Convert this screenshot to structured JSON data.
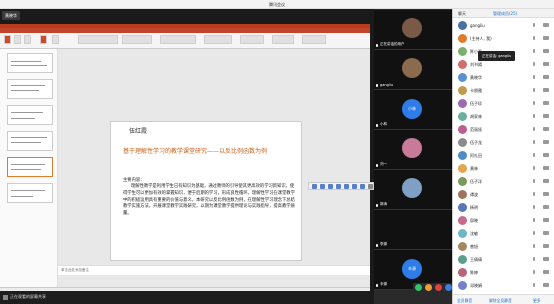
{
  "window": {
    "title": "腾讯会议"
  },
  "share_tag": "黄晓华",
  "slide": {
    "author": "伍红霞",
    "title": "基于理解性学习的教学课堂研究——以反比例函数为例",
    "keywords_label": "主要内容：",
    "body": "理解性教学是利用学生已有知识为基础，通过教师的引导使其更高效的学习新知识，使得学生可以更加有效的掌握知识，便于后期的学习，形成良性循环。理解性学习在课堂教学中的积极运用具有重要的价值与意义，本研究以反比例函数为例，在理解性学习理念下总结教学实施方法，开展课堂教学实践研究，以期为课堂教学提供理论与实践指导，提高教学质量。",
    "notes_placeholder": "单击此处添加备注"
  },
  "share_bottom": {
    "label": "正在观看的屏幕共享"
  },
  "video_tiles": [
    {
      "label": "正在讲话的用户",
      "kind": "face",
      "color": "#7a5a46"
    },
    {
      "label": "gangliu",
      "kind": "face",
      "color": "#8c6a4d"
    },
    {
      "label": "小林",
      "kind": "bubble",
      "color": "#2d7ce8"
    },
    {
      "label": "刘一",
      "kind": "face",
      "color": "#c87b98"
    },
    {
      "label": "郭涛",
      "kind": "face",
      "color": "#7fa0c4"
    },
    {
      "label": "李源",
      "kind": "none",
      "color": "#111111"
    },
    {
      "label": "辛源",
      "kind": "bubble",
      "color": "#2d7ce8"
    }
  ],
  "tooltip": "正在讲话: gangliu",
  "participants": {
    "tabs": [
      "聊天",
      "管理成员(25)"
    ],
    "rows": [
      {
        "name": "gangliu",
        "color": "#4a6fa5"
      },
      {
        "name": "(主持人, 我)",
        "color": "#e07b2a"
      },
      {
        "name": "陈小军",
        "color": "#7bb06a"
      },
      {
        "name": "刘书嫣",
        "color": "#d36c6c"
      },
      {
        "name": "黄晓华",
        "color": "#5a8fd1"
      },
      {
        "name": "卡朋雅",
        "color": "#c29a4c"
      },
      {
        "name": "伍子珍",
        "color": "#9b6bb2"
      },
      {
        "name": "胡家林",
        "color": "#6ab0a0"
      },
      {
        "name": "范丽娅",
        "color": "#bf5d8e"
      },
      {
        "name": "伍子龙",
        "color": "#8c8c8c"
      },
      {
        "name": "阿扎田",
        "color": "#4d8bc9"
      },
      {
        "name": "黄林",
        "color": "#e3a54f"
      },
      {
        "name": "伍子洋",
        "color": "#7a9a5a"
      },
      {
        "name": "谭波",
        "color": "#a0745a"
      },
      {
        "name": "杨明",
        "color": "#5876b8"
      },
      {
        "name": "邱晓",
        "color": "#c9698e"
      },
      {
        "name": "沈敏",
        "color": "#6fb5c2"
      },
      {
        "name": "曾旭",
        "color": "#a6865c"
      },
      {
        "name": "王倩倩",
        "color": "#5c9e8a"
      },
      {
        "name": "陈婷",
        "color": "#b5667a"
      },
      {
        "name": "邓晓娟",
        "color": "#7680c9"
      }
    ],
    "footer": [
      "全员静音",
      "解除全员静音",
      "更多"
    ]
  }
}
